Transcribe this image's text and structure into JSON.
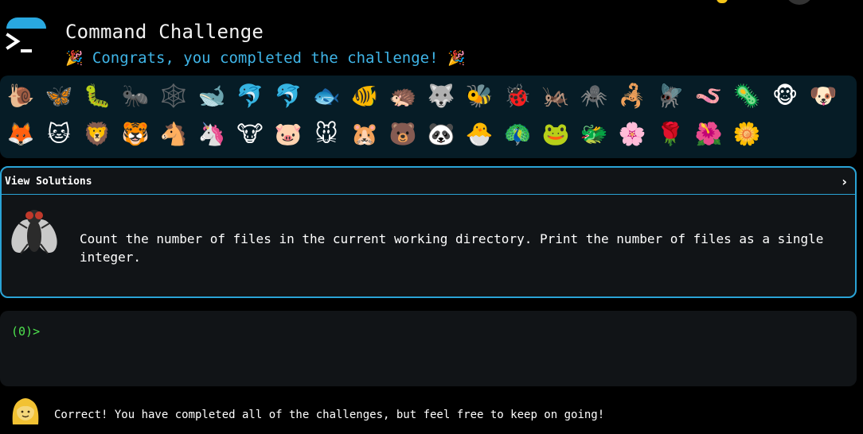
{
  "header": {
    "title": "Command Challenge",
    "congrats_text": "Congrats, you completed the challenge!",
    "party_emoji": "🎉"
  },
  "animals": {
    "row1": [
      "🐌",
      "🦋",
      "🐛",
      "🐜",
      "🕸️",
      "🐋",
      "🐬",
      "🐬",
      "🐟",
      "🐠",
      "🦔",
      "🐺",
      "🐝",
      "🐞",
      "🦗",
      "🕷️",
      "🦂",
      "🪰",
      "🪱",
      "🦠",
      "🐵",
      "🐶"
    ],
    "row2": [
      "🦊",
      "🐱",
      "🦁",
      "🐯",
      "🐴",
      "🦄",
      "🐮",
      "🐷",
      "🐭",
      "🐹",
      "🐻",
      "🐼",
      "🐣",
      "🦚",
      "🐸",
      "🐲",
      "🌸",
      "🌹",
      "🌺",
      "🌼"
    ]
  },
  "solutions": {
    "toggle_label": "View Solutions",
    "chevron": "›",
    "task_icon": "fly-icon",
    "task_text": "Count the number of files in the current working directory. Print the number of files as a single integer."
  },
  "terminal": {
    "prompt": "(0)>"
  },
  "footer": {
    "avatar_icon": "woman-face-icon",
    "message": "Correct! You have completed all of the challenges, but feel free to keep on going!"
  },
  "colors": {
    "accent": "#2aa3d6",
    "congrats": "#3fb4e6",
    "prompt": "#4ee24e",
    "panel_bg": "#111417",
    "animals_bg": "#061c26"
  }
}
